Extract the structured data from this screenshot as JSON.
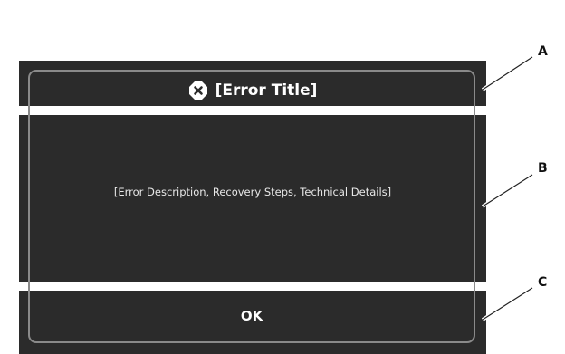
{
  "dialog": {
    "title": "[Error Title]",
    "description": "[Error Description, Recovery Steps, Technical Details]",
    "ok_label": "OK",
    "icon": "error-x-icon"
  },
  "callouts": {
    "a": "A",
    "b": "B",
    "c": "C"
  },
  "colors": {
    "dialog_background": "#2b2b2b",
    "outline": "#8a8a8a",
    "text": "#ffffff"
  }
}
